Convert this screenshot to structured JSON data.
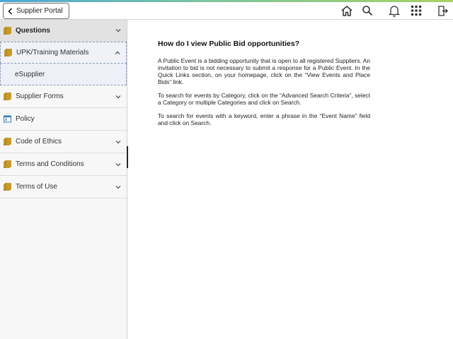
{
  "header": {
    "back_label": "Supplier Portal",
    "icons": [
      "home-icon",
      "search-icon",
      "bell-icon",
      "grid-menu-icon",
      "signout-icon"
    ]
  },
  "sidebar": {
    "items": [
      {
        "label": "Questions",
        "icon": "folder-icon",
        "state": "selected"
      },
      {
        "label": "UPK/Training Materials",
        "icon": "folder-icon",
        "state": "expanded"
      },
      {
        "label": "eSupplier",
        "icon": "",
        "state": "child"
      },
      {
        "label": "Supplier Forms",
        "icon": "folder-icon",
        "state": "collapsed"
      },
      {
        "label": "Policy",
        "icon": "page-icon",
        "state": "leaf"
      },
      {
        "label": "Code of Ethics",
        "icon": "folder-icon",
        "state": "collapsed"
      },
      {
        "label": "Terms and Conditions",
        "icon": "folder-icon",
        "state": "collapsed"
      },
      {
        "label": "Terms of Use",
        "icon": "folder-icon",
        "state": "collapsed"
      }
    ]
  },
  "article": {
    "title": "How do I view Public Bid opportunities?",
    "paragraphs": [
      "A Public Event is a bidding opportunity that is open to all registered Suppliers. An invitation to bid is not necessary to submit a response for a Public Event. In the Quick Links section, on your homepage, click on the “View Events and Place Bids” link.",
      "To search for events by Category, click on the “Advanced Search Criteria”, select a Category or multiple Categories and click on Search.",
      "To search for events with a keyword, enter a phrase in the “Event Name” field and click on Search."
    ]
  },
  "colors": {
    "folder": "#c89a2e",
    "handle": "#1d2a3d",
    "accent_start": "#4ea6d6",
    "accent_end": "#a7d163"
  }
}
